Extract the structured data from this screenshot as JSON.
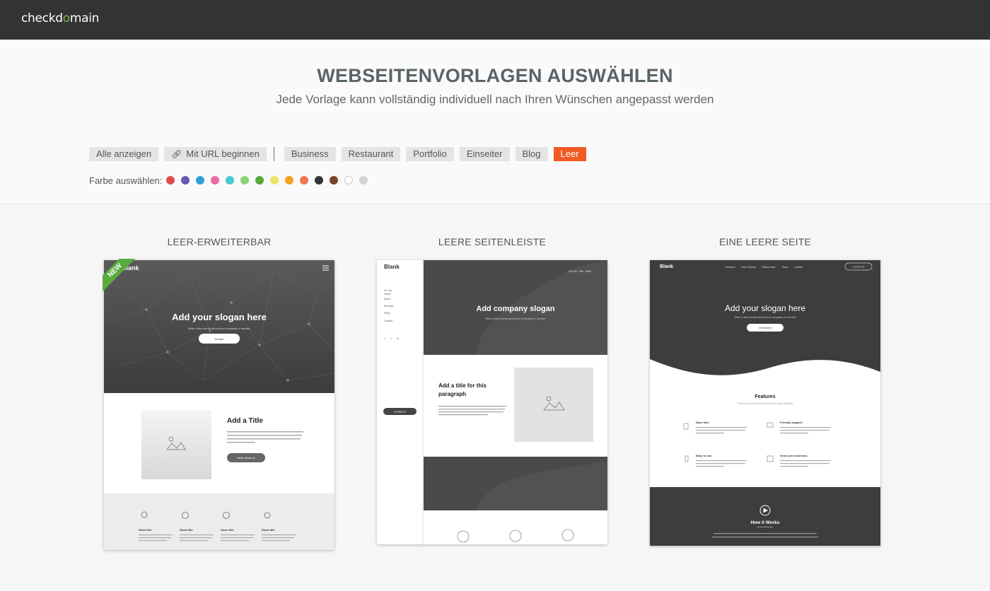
{
  "header": {
    "logo_text_a": "checkd",
    "logo_text_o": "o",
    "logo_text_b": "main"
  },
  "intro": {
    "title": "WEBSEITENVORLAGEN AUSWÄHLEN",
    "subtitle": "Jede Vorlage kann vollständig individuell nach Ihren Wünschen angepasst werden"
  },
  "filters": {
    "show_all": "Alle anzeigen",
    "with_url": "Mit URL beginnen",
    "categories": [
      "Business",
      "Restaurant",
      "Portfolio",
      "Einseiter",
      "Blog",
      "Leer"
    ],
    "active": "Leer",
    "active_color": "#f15a22"
  },
  "colors": {
    "label": "Farbe auswählen:",
    "swatches": [
      "#e24a4a",
      "#6b56b8",
      "#2f9fd6",
      "#e86aa6",
      "#48c9cf",
      "#8dd07a",
      "#58a93a",
      "#ece36a",
      "#f4a21f",
      "#ef7650",
      "#333333",
      "#7a4426",
      "#ffffff",
      "#d2d2d2"
    ]
  },
  "templates": [
    {
      "title": "LEER-ERWEITERBAR",
      "badge": "NEW",
      "preview": {
        "brand": "Blank",
        "hero_title": "Add your slogan here",
        "hero_text": "Write a few words about your company or service",
        "hero_button": "Donate",
        "section_title": "Add a Title",
        "section_text": "This is a paragraph. Writing in paragraphs lets your visitors find what they are looking for quickly and easily. Make sure the title suits the content of this text.",
        "section_button": "More about us",
        "feature_title": "Short title",
        "feature_text": "Describe a company feature in the current paragraph about it and choose an appropriate icon."
      }
    },
    {
      "title": "LEERE SEITENLEISTE",
      "preview": {
        "brand": "Blank",
        "top_info": "Call 555 - 555 - 5555",
        "nav_top": "Go Top",
        "nav_items": [
          "Home",
          "About",
          "Services",
          "FAQs",
          "Contact"
        ],
        "social": [
          "f",
          "t",
          "in"
        ],
        "contact_button": "Contact us",
        "hero_title": "Add company slogan",
        "hero_text": "Write a few words about the company or service",
        "section_title_1": "Add a title for this",
        "section_title_2": "paragraph",
        "section_text": "This is a paragraph. Writing in paragraphs lets visitors find what they are looking for quickly and easily. Make sure the title suits the content of this text."
      }
    },
    {
      "title": "EINE LEERE SEITE",
      "preview": {
        "brand": "Blank",
        "nav_items": [
          "Features",
          "How it Works",
          "Testimonials",
          "Plans",
          "Contact"
        ],
        "nav_button": "Contact us",
        "hero_title": "Add your slogan here",
        "hero_text": "Write a few words about your company or service",
        "hero_button": "Get Started",
        "features_title": "Features",
        "features_sub": "There's a world of business with our great features",
        "features": [
          {
            "title": "Save time",
            "text": "With our platform, you'll save time when you don't need to spend winning your customers."
          },
          {
            "title": "Friendly support",
            "text": "Our support team is ready around things and are pleased to be always by good at other things."
          },
          {
            "title": "Easy to use",
            "text": "Learning how to use our product takes just a few minutes, and everything about using it is super simple."
          },
          {
            "title": "Grow your business",
            "text": "Watch your profits and efficiency rise! You'll expand faster than you thought possible."
          }
        ],
        "how_title": "How it Works",
        "how_text": "Insert a video that shows the benefits of your product or service and add a short explanation below. No need to overload with text, since the video should speak for itself."
      }
    }
  ]
}
